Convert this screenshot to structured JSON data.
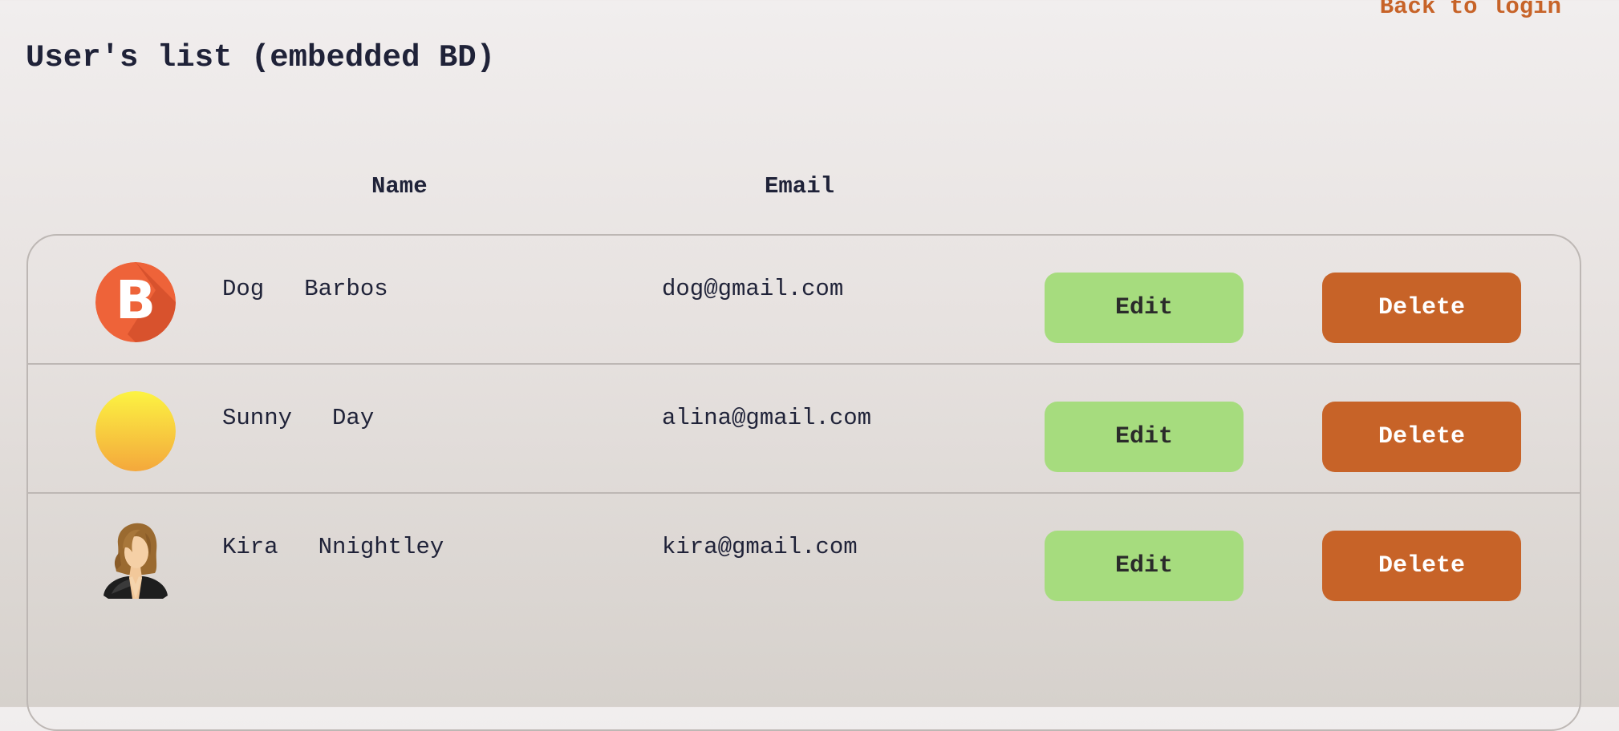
{
  "header": {
    "back_link": "Back to login",
    "title": "User's list (embedded BD)"
  },
  "columns": {
    "name": "Name",
    "email": "Email"
  },
  "users": [
    {
      "first_name": "Dog",
      "last_name": "Barbos",
      "email": "dog@gmail.com",
      "avatar": "letter-b-avatar",
      "avatar_letter": "B",
      "avatar_color": "#ee6339",
      "edit_label": "Edit",
      "delete_label": "Delete"
    },
    {
      "first_name": "Sunny",
      "last_name": "Day",
      "email": "alina@gmail.com",
      "avatar": "sun-gradient-avatar",
      "avatar_colors": [
        "#fcf342",
        "#f4a83c"
      ],
      "edit_label": "Edit",
      "delete_label": "Delete"
    },
    {
      "first_name": "Kira",
      "last_name": "Nnightley",
      "email": "kira@gmail.com",
      "avatar": "woman-avatar",
      "edit_label": "Edit",
      "delete_label": "Delete"
    }
  ],
  "colors": {
    "edit_button": "#a6dc7e",
    "delete_button": "#c76328",
    "link": "#c76328",
    "text": "#1f2238"
  }
}
